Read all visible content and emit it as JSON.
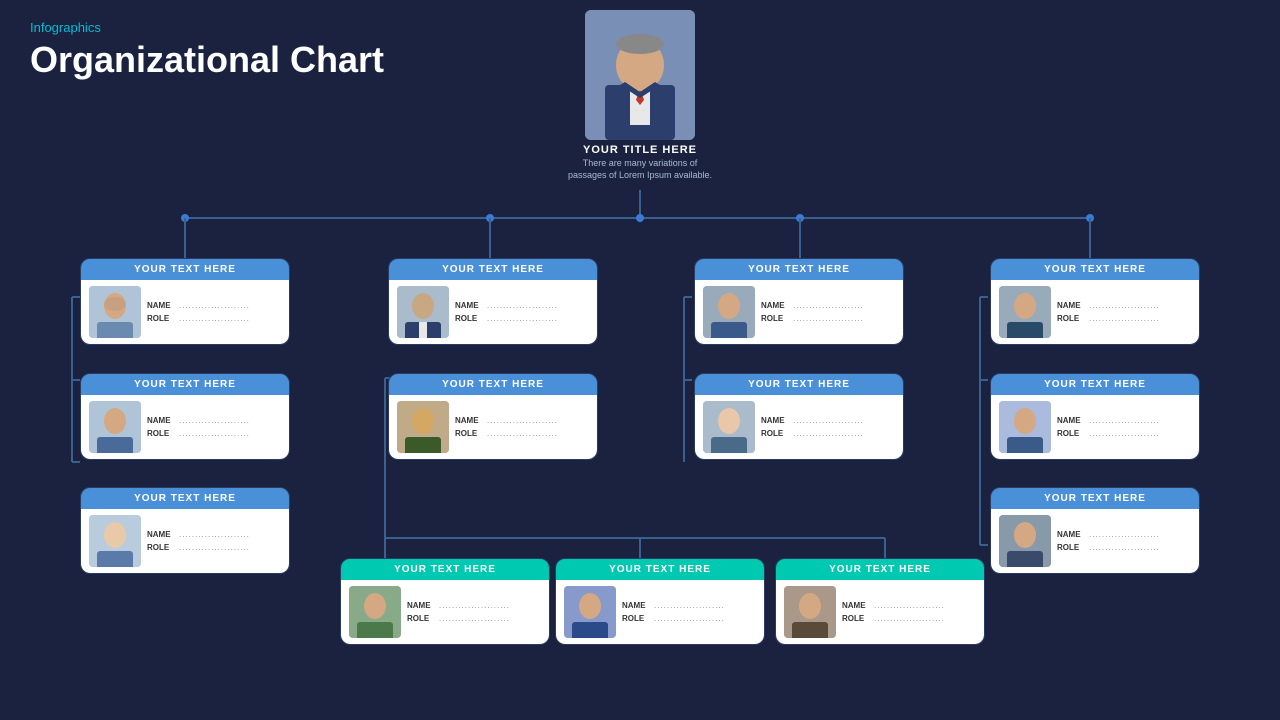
{
  "header": {
    "label": "Infographics",
    "title": "Organizational Chart"
  },
  "top_node": {
    "title": "YOUR TITLE HERE",
    "subtitle": "There are many variations of passages of Lorem Ipsum available.",
    "photo_alt": "executive-photo"
  },
  "cards": {
    "col1_row1": {
      "header": "YOUR TEXT HERE",
      "name_label": "NAME",
      "role_label": "ROLE",
      "name_dots": "......................",
      "role_dots": "......................"
    },
    "col1_row2": {
      "header": "YOUR TEXT HERE",
      "name_label": "NAME",
      "role_label": "ROLE",
      "name_dots": "......................",
      "role_dots": "......................"
    },
    "col1_row3": {
      "header": "YOUR TEXT HERE",
      "name_label": "NAME",
      "role_label": "ROLE",
      "name_dots": "......................",
      "role_dots": "......................"
    },
    "col2_row1": {
      "header": "YOUR TEXT HERE",
      "name_label": "NAME",
      "role_label": "ROLE",
      "name_dots": "......................",
      "role_dots": "......................"
    },
    "col2_row2": {
      "header": "YOUR TEXT HERE",
      "name_label": "NAME",
      "role_label": "ROLE",
      "name_dots": "......................",
      "role_dots": "......................"
    },
    "col2_bot1": {
      "header": "YOUR TEXT HERE",
      "name_label": "NAME",
      "role_label": "ROLE",
      "name_dots": "......................",
      "role_dots": "......................"
    },
    "col2_bot2": {
      "header": "YOUR TEXT HERE",
      "name_label": "NAME",
      "role_label": "ROLE",
      "name_dots": "......................",
      "role_dots": "......................"
    },
    "col2_bot3": {
      "header": "YOUR TEXT HERE",
      "name_label": "NAME",
      "role_label": "ROLE",
      "name_dots": "......................",
      "role_dots": "......................"
    },
    "col3_row1": {
      "header": "YOUR TEXT HERE",
      "name_label": "NAME",
      "role_label": "ROLE",
      "name_dots": "......................",
      "role_dots": "......................"
    },
    "col3_row2": {
      "header": "YOUR TEXT HERE",
      "name_label": "NAME",
      "role_label": "ROLE",
      "name_dots": "......................",
      "role_dots": "......................"
    },
    "col4_row1": {
      "header": "YOUR TEXT HERE",
      "name_label": "NAME",
      "role_label": "ROLE",
      "name_dots": "......................",
      "role_dots": "......................"
    },
    "col4_row2": {
      "header": "YOUR TEXT HERE",
      "name_label": "NAME",
      "role_label": "ROLE",
      "name_dots": "......................",
      "role_dots": "......................"
    },
    "col4_row3": {
      "header": "YOUR TEXT HERE",
      "name_label": "NAME",
      "role_label": "ROLE",
      "name_dots": "......................",
      "role_dots": "......................"
    }
  },
  "colors": {
    "bg": "#1a2240",
    "blue_header": "#4a90d9",
    "teal_header": "#00c9b1",
    "card_bg": "#ffffff",
    "accent": "#00bcd4",
    "line_color": "#3a6090"
  }
}
